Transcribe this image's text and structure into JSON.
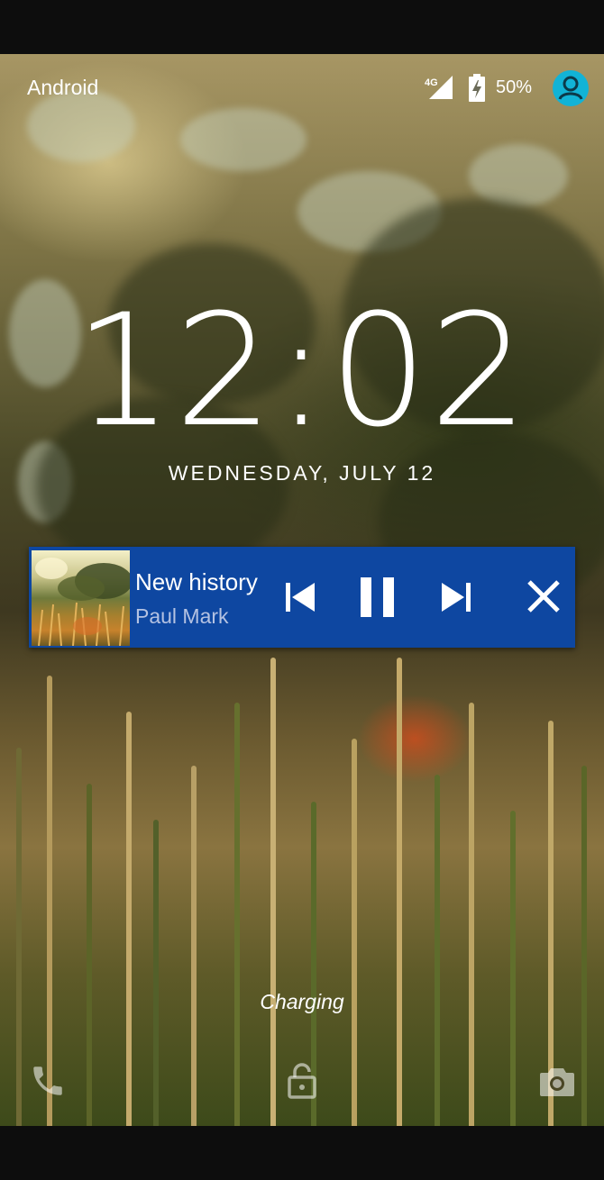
{
  "status_bar": {
    "carrier": "Android",
    "network": "4G",
    "battery_percent": "50%",
    "icons": [
      "signal-4g-icon",
      "battery-charging-icon",
      "user-avatar-icon"
    ]
  },
  "lock_screen": {
    "time": "12:02",
    "date": "WEDNESDAY, JULY 12",
    "charging_text": "Charging"
  },
  "media_notification": {
    "title": "New history",
    "artist": "Paul Mark",
    "background_color": "#0e47a1",
    "controls": [
      "skip-previous-icon",
      "pause-icon",
      "skip-next-icon",
      "close-icon"
    ]
  },
  "bottom_shortcuts": [
    "phone-icon",
    "unlock-icon",
    "camera-icon"
  ]
}
